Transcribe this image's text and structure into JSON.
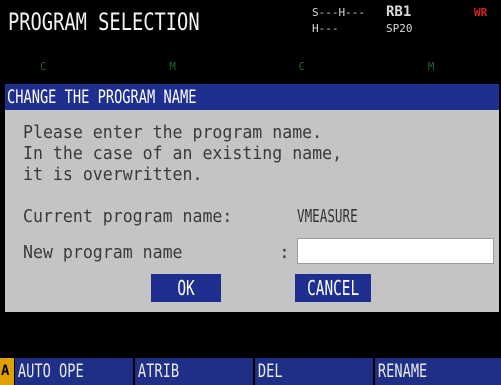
{
  "header": {
    "title": "PROGRAM SELECTION",
    "status": {
      "line1_left": "S---H---",
      "line2_left": "H---",
      "line1_right": "RB1",
      "line2_right": "SP20",
      "flag": "WR"
    }
  },
  "background_strip": "C M C M",
  "dialog": {
    "title": "CHANGE THE PROGRAM NAME",
    "message_lines": [
      "Please enter the program name.",
      "In the case of an existing name,",
      "it is overwritten."
    ],
    "current_label": "Current program name:",
    "current_value": "VMEASURE",
    "new_label": "New program name",
    "new_colon": ":",
    "new_value": "",
    "ok_label": "OK",
    "cancel_label": "CANCEL"
  },
  "function_bar": {
    "indicator": "A",
    "keys": [
      "AUTO OPE",
      "ATRIB",
      "DEL",
      "RENAME"
    ]
  },
  "colors": {
    "dialog_titlebar": "#1e2f8f",
    "dialog_body": "#c4c4c4",
    "function_key": "#1f2f86",
    "indicator": "#e0a000"
  }
}
